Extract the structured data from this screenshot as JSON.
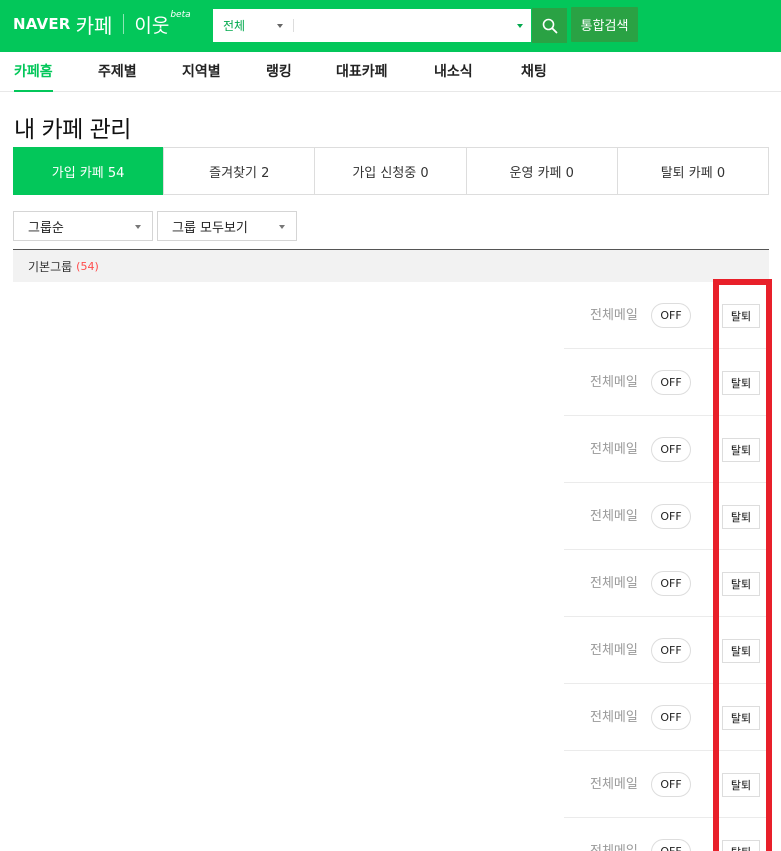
{
  "header": {
    "logo_naver": "NAVER",
    "logo_cafe": "카페",
    "logo_neighbor": "이웃",
    "logo_beta": "beta",
    "search_scope": "전체",
    "search_value": "",
    "search_placeholder": "",
    "total_search_label": "통합검색"
  },
  "nav": {
    "items": [
      {
        "label": "카페홈",
        "active": true
      },
      {
        "label": "주제별"
      },
      {
        "label": "지역별"
      },
      {
        "label": "랭킹"
      },
      {
        "label": "대표카페"
      },
      {
        "label": "내소식"
      },
      {
        "label": "채팅"
      }
    ]
  },
  "page_title": "내 카페 관리",
  "tabs": [
    {
      "label": "가입 카페 54",
      "active": true
    },
    {
      "label": "즐겨찾기 2"
    },
    {
      "label": "가입 신청중 0"
    },
    {
      "label": "운영 카페 0"
    },
    {
      "label": "탈퇴 카페 0"
    }
  ],
  "filters": {
    "sort": "그룹순",
    "group_view": "그룹 모두보기"
  },
  "group": {
    "name": "기본그룹",
    "count": "(54)"
  },
  "rows": [
    {
      "mail_label": "전체메일",
      "toggle": "OFF",
      "withdraw": "탈퇴"
    },
    {
      "mail_label": "전체메일",
      "toggle": "OFF",
      "withdraw": "탈퇴"
    },
    {
      "mail_label": "전체메일",
      "toggle": "OFF",
      "withdraw": "탈퇴"
    },
    {
      "mail_label": "전체메일",
      "toggle": "OFF",
      "withdraw": "탈퇴"
    },
    {
      "mail_label": "전체메일",
      "toggle": "OFF",
      "withdraw": "탈퇴"
    },
    {
      "mail_label": "전체메일",
      "toggle": "OFF",
      "withdraw": "탈퇴"
    },
    {
      "mail_label": "전체메일",
      "toggle": "OFF",
      "withdraw": "탈퇴"
    },
    {
      "mail_label": "전체메일",
      "toggle": "OFF",
      "withdraw": "탈퇴"
    },
    {
      "mail_label": "전체메일",
      "toggle": "OFF",
      "withdraw": "탈퇴"
    }
  ],
  "colors": {
    "brand": "#03c75a",
    "button_green": "#2aa244",
    "highlight": "#e8202a",
    "count_red": "#ff4b4b"
  }
}
